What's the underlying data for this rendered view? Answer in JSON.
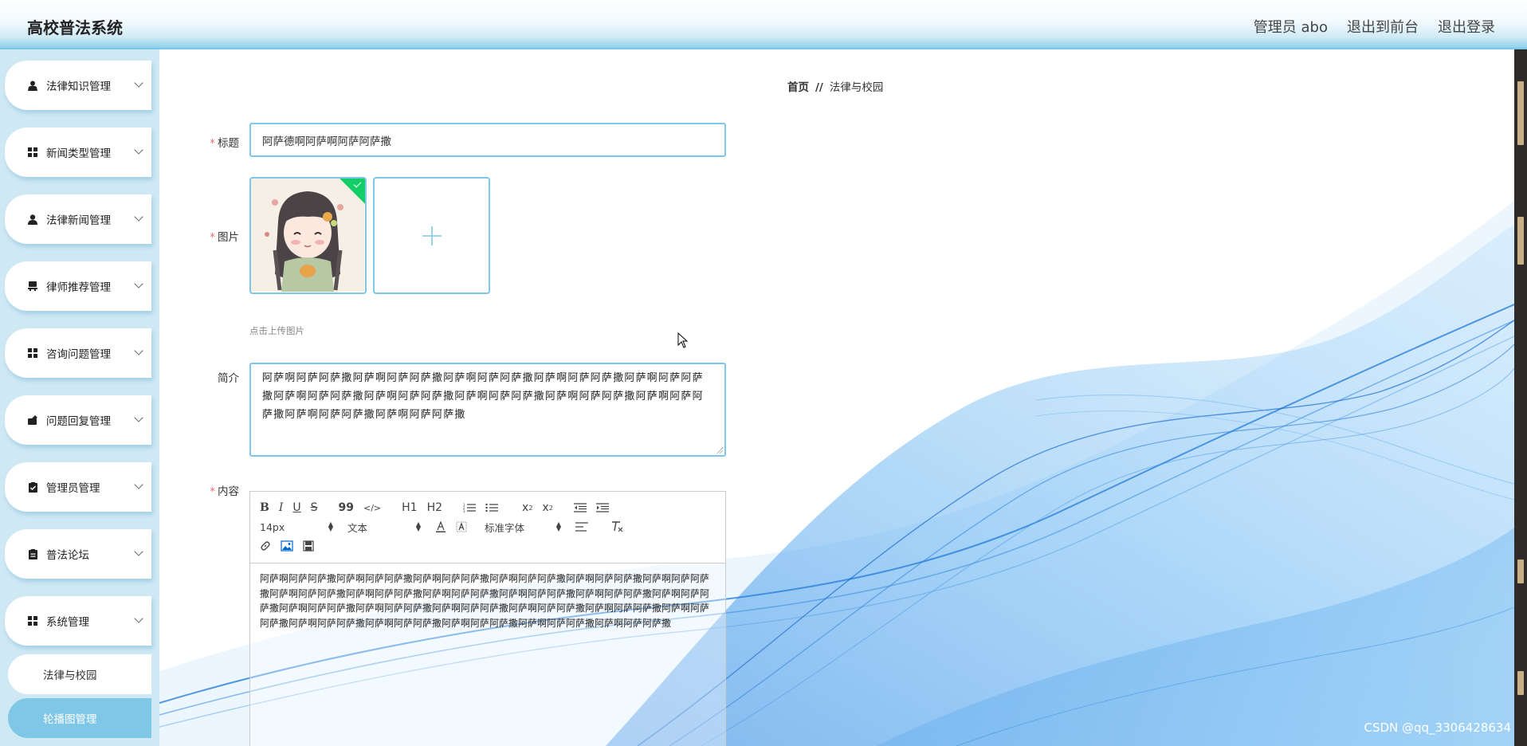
{
  "header": {
    "app_title": "高校普法系统",
    "admin_label": "管理员 abo",
    "exit_front_label": "退出到前台",
    "logout_label": "退出登录"
  },
  "sidebar": {
    "items": [
      {
        "label": "法律知识管理",
        "icon": "user-tie-icon"
      },
      {
        "label": "新闻类型管理",
        "icon": "grid-icon"
      },
      {
        "label": "法律新闻管理",
        "icon": "user-icon"
      },
      {
        "label": "律师推荐管理",
        "icon": "chair-icon"
      },
      {
        "label": "咨询问题管理",
        "icon": "grid-icon"
      },
      {
        "label": "问题回复管理",
        "icon": "reply-icon"
      },
      {
        "label": "管理员管理",
        "icon": "clipboard-check-icon"
      },
      {
        "label": "普法论坛",
        "icon": "clipboard-icon"
      },
      {
        "label": "系统管理",
        "icon": "grid-icon"
      }
    ],
    "sub_items": [
      {
        "label": "法律与校园",
        "active": false
      },
      {
        "label": "轮播图管理",
        "active": true
      }
    ]
  },
  "breadcrumb": {
    "home": "首页",
    "separator": "//",
    "current": "法律与校园"
  },
  "form": {
    "title_label": "标题",
    "title_value": "阿萨德啊阿萨啊阿萨阿萨撒",
    "image_label": "图片",
    "upload_tip": "点击上传图片",
    "intro_label": "简介",
    "intro_value": "阿萨啊阿萨阿萨撒阿萨啊阿萨阿萨撒阿萨啊阿萨阿萨撒阿萨啊阿萨阿萨撒阿萨啊阿萨阿萨撒阿萨啊阿萨阿萨撒阿萨啊阿萨阿萨撒阿萨啊阿萨阿萨撒阿萨啊阿萨阿萨撒阿萨啊阿萨阿萨撒阿萨啊阿萨阿萨撒阿萨啊阿萨阿萨撒",
    "content_label": "内容",
    "content_value": "阿萨啊阿萨阿萨撒阿萨啊阿萨阿萨撒阿萨啊阿萨阿萨撒阿萨啊阿萨阿萨撒阿萨啊阿萨阿萨撒阿萨啊阿萨阿萨撒阿萨啊阿萨阿萨撒阿萨啊阿萨阿萨撒阿萨啊阿萨阿萨撒阿萨啊阿萨阿萨撒阿萨啊阿萨阿萨撒阿萨啊阿萨阿萨撒阿萨啊阿萨阿萨撒阿萨啊阿萨阿萨撒阿萨啊阿萨阿萨撒阿萨啊阿萨阿萨撒阿萨啊阿萨阿萨撒阿萨啊阿萨阿萨撒阿萨啊阿萨阿萨撒阿萨啊阿萨阿萨撒阿萨啊阿萨阿萨撒阿萨啊阿萨阿萨撒阿萨啊阿萨阿萨撒"
  },
  "editor_toolbar": {
    "bold": "B",
    "italic": "I",
    "underline": "U",
    "strike": "S",
    "quote": "99",
    "code": "</>",
    "h1": "H1",
    "h2": "H2",
    "sub": "x2",
    "sup": "x2",
    "size_select": "14px",
    "header_select": "文本",
    "font_select": "标准字体"
  },
  "watermark": "CSDN @qq_3306428634",
  "colors": {
    "accent": "#7fc7e6",
    "required": "#f56c6c",
    "upload_success": "#13ce66"
  }
}
